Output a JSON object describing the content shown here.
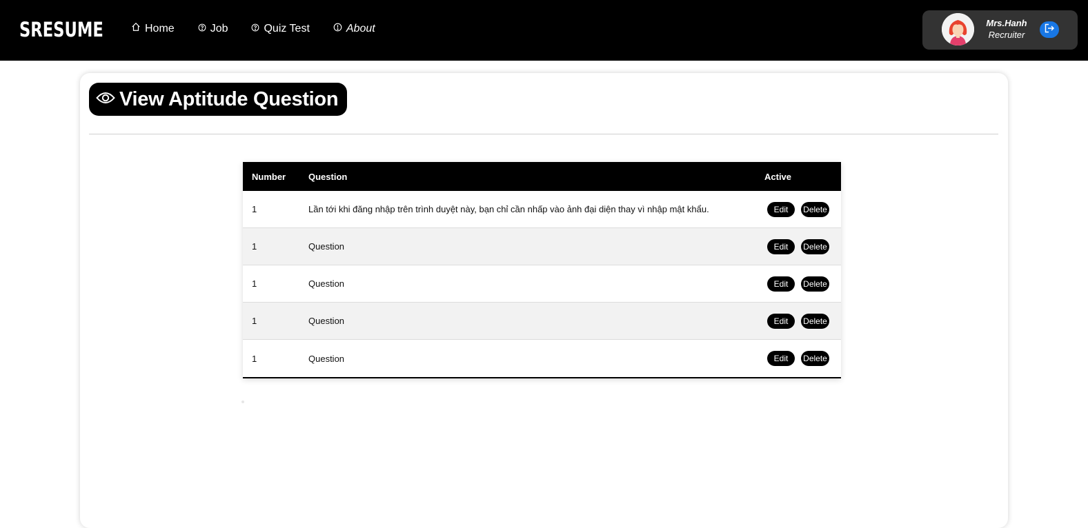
{
  "brand": {
    "logo_text": "SRESUME"
  },
  "nav": {
    "items": [
      {
        "label": "Home",
        "icon": "home-icon"
      },
      {
        "label": "Job",
        "icon": "help-circle-icon"
      },
      {
        "label": "Quiz Test",
        "icon": "help-circle-icon"
      },
      {
        "label": "About",
        "icon": "info-circle-icon"
      }
    ]
  },
  "user": {
    "name": "Mrs.Hanh",
    "role": "Recruiter",
    "logout_icon": "logout-icon"
  },
  "page": {
    "title": "View Aptitude Question",
    "title_icon": "eye-icon"
  },
  "table": {
    "headers": {
      "number": "Number",
      "question": "Question",
      "active": "Active"
    },
    "rows": [
      {
        "number": "1",
        "question": "Lần tới khi đăng nhập trên trình duyệt này, bạn chỉ cần nhấp vào ảnh đại diện thay vì nhập mật khẩu.",
        "edit": "Edit",
        "delete": "Delete"
      },
      {
        "number": "1",
        "question": "Question",
        "edit": "Edit",
        "delete": "Delete"
      },
      {
        "number": "1",
        "question": "Question",
        "edit": "Edit",
        "delete": "Delete"
      },
      {
        "number": "1",
        "question": "Question",
        "edit": "Edit",
        "delete": "Delete"
      },
      {
        "number": "1",
        "question": "Question",
        "edit": "Edit",
        "delete": "Delete"
      }
    ]
  },
  "colors": {
    "navbar": "#000000",
    "accent_blue": "#1877e5",
    "user_box": "#333333",
    "row_alt": "#f2f2f2"
  }
}
